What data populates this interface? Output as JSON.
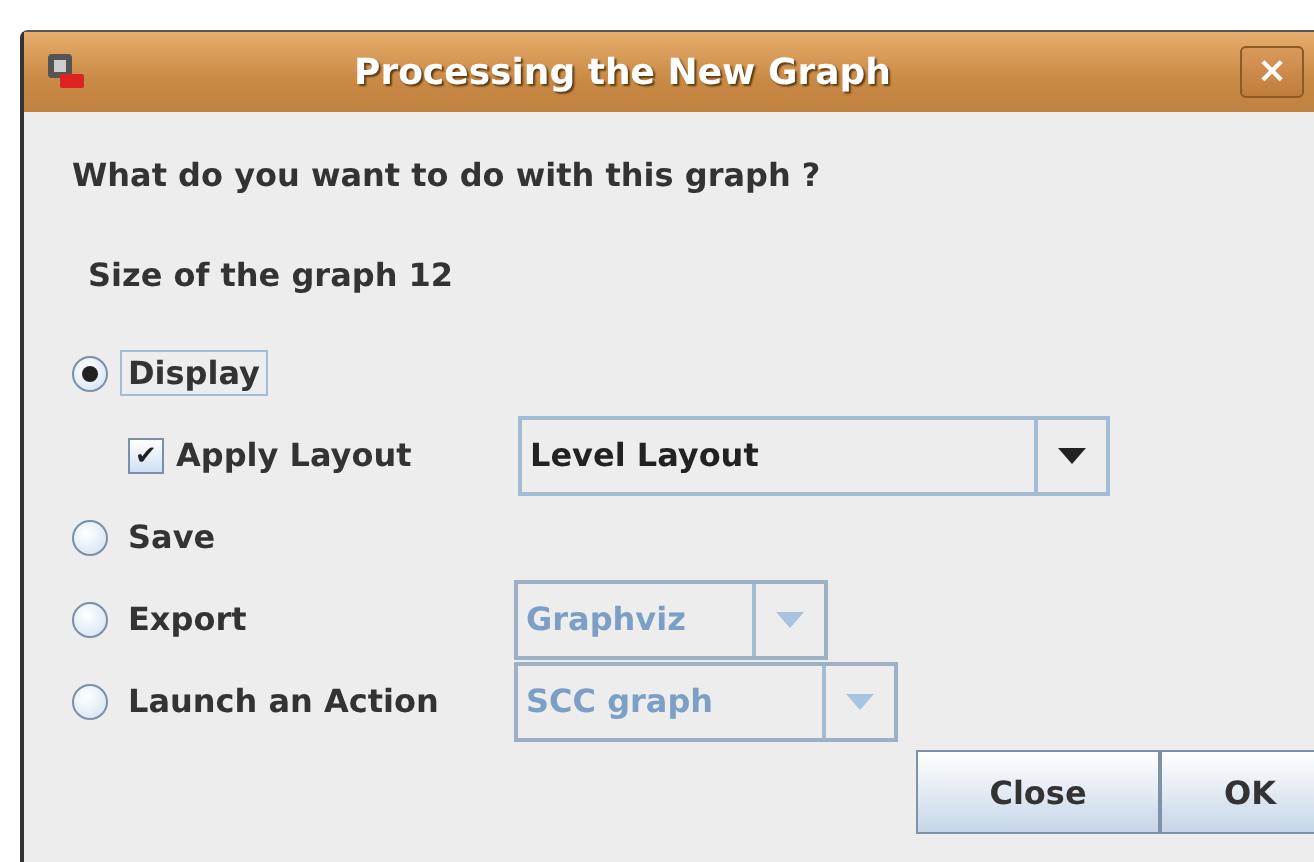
{
  "window": {
    "title": "Processing the New Graph",
    "close": "×"
  },
  "question": "What do you want to do with this graph ?",
  "size_label": "Size of the graph 12",
  "options": [
    {
      "label": "Display",
      "selected": true,
      "focused": true,
      "kind": "plain",
      "sub": {
        "label": "Apply Layout",
        "checked": true,
        "mark": "✔",
        "combo": {
          "value": "Level Layout",
          "disabled": false
        }
      }
    },
    {
      "label": "Save",
      "selected": false,
      "focused": false,
      "kind": "plain"
    },
    {
      "label": "Export",
      "selected": false,
      "focused": false,
      "kind": "combo",
      "combo": {
        "value": "Graphviz",
        "disabled": true
      }
    },
    {
      "label": "Launch an Action",
      "selected": false,
      "focused": false,
      "kind": "combo",
      "combo": {
        "value": "SCC graph",
        "disabled": true
      }
    }
  ],
  "buttons": [
    "Close",
    "OK"
  ]
}
